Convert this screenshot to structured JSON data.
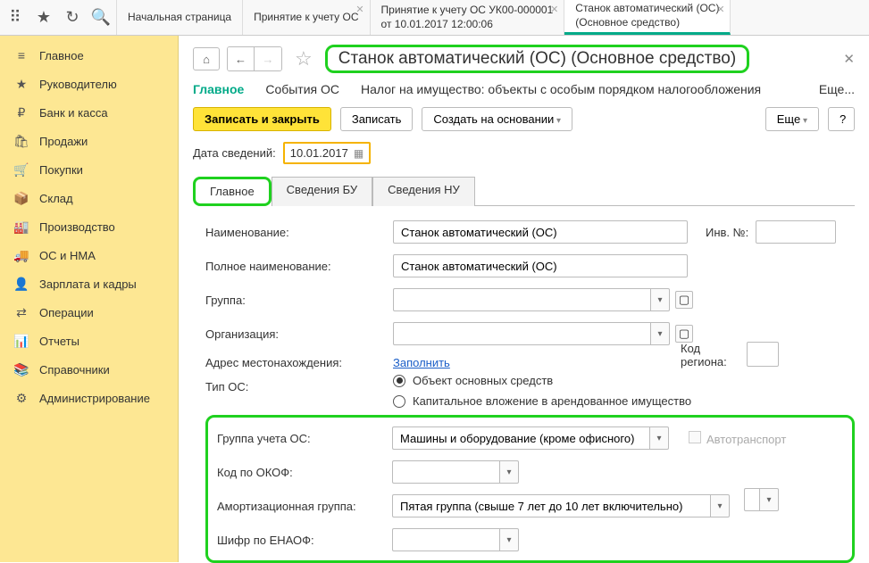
{
  "topTabs": [
    {
      "line1": "Начальная страница",
      "line2": "",
      "closable": false
    },
    {
      "line1": "Принятие к учету ОС",
      "line2": "",
      "closable": true
    },
    {
      "line1": "Принятие к учету ОС УК00-000001",
      "line2": "от 10.01.2017 12:00:06",
      "closable": true
    },
    {
      "line1": "Станок автоматический (ОС)",
      "line2": "(Основное средство)",
      "closable": true,
      "active": true
    }
  ],
  "sidebar": [
    {
      "icon": "≡",
      "label": "Главное"
    },
    {
      "icon": "★",
      "label": "Руководителю"
    },
    {
      "icon": "₽",
      "label": "Банк и касса"
    },
    {
      "icon": "🛍",
      "label": "Продажи"
    },
    {
      "icon": "🛒",
      "label": "Покупки"
    },
    {
      "icon": "📦",
      "label": "Склад"
    },
    {
      "icon": "🏭",
      "label": "Производство"
    },
    {
      "icon": "🚚",
      "label": "ОС и НМА"
    },
    {
      "icon": "👤",
      "label": "Зарплата и кадры"
    },
    {
      "icon": "⇄",
      "label": "Операции"
    },
    {
      "icon": "📊",
      "label": "Отчеты"
    },
    {
      "icon": "📚",
      "label": "Справочники"
    },
    {
      "icon": "⚙",
      "label": "Администрирование"
    }
  ],
  "pageTitle": "Станок автоматический (ОС) (Основное средство)",
  "subNav": {
    "main": "Главное",
    "events": "События ОС",
    "tax": "Налог на имущество: объекты с особым порядком налогообложения",
    "more": "Еще..."
  },
  "actions": {
    "saveClose": "Записать и закрыть",
    "save": "Записать",
    "createBasedOn": "Создать на основании",
    "more": "Еще",
    "help": "?"
  },
  "dateLabel": "Дата сведений:",
  "dateValue": "10.01.2017",
  "formTabs": {
    "main": "Главное",
    "bu": "Сведения БУ",
    "nu": "Сведения НУ"
  },
  "fields": {
    "nameLabel": "Наименование:",
    "nameValue": "Станок автоматический (ОС)",
    "invNoLabel": "Инв. №:",
    "invNoValue": "",
    "fullNameLabel": "Полное наименование:",
    "fullNameValue": "Станок автоматический (ОС)",
    "groupLabel": "Группа:",
    "groupValue": "",
    "orgLabel": "Организация:",
    "orgValue": "",
    "addressLabel": "Адрес местонахождения:",
    "addressLink": "Заполнить",
    "regionCodeLabel": "Код региона:",
    "regionCodeValue": "",
    "typeLabel": "Тип ОС:",
    "radio1": "Объект основных средств",
    "radio2": "Капитальное вложение в арендованное имущество",
    "accGroupLabel": "Группа учета ОС:",
    "accGroupValue": "Машины и оборудование (кроме офисного)",
    "autoTransLabel": "Автотранспорт",
    "okofLabel": "Код по ОКОФ:",
    "okofValue": "",
    "amortLabel": "Амортизационная группа:",
    "amortValue": "Пятая группа (свыше 7 лет до 10 лет включительно)",
    "enaofLabel": "Шифр по ЕНАОФ:",
    "enaofValue": ""
  }
}
